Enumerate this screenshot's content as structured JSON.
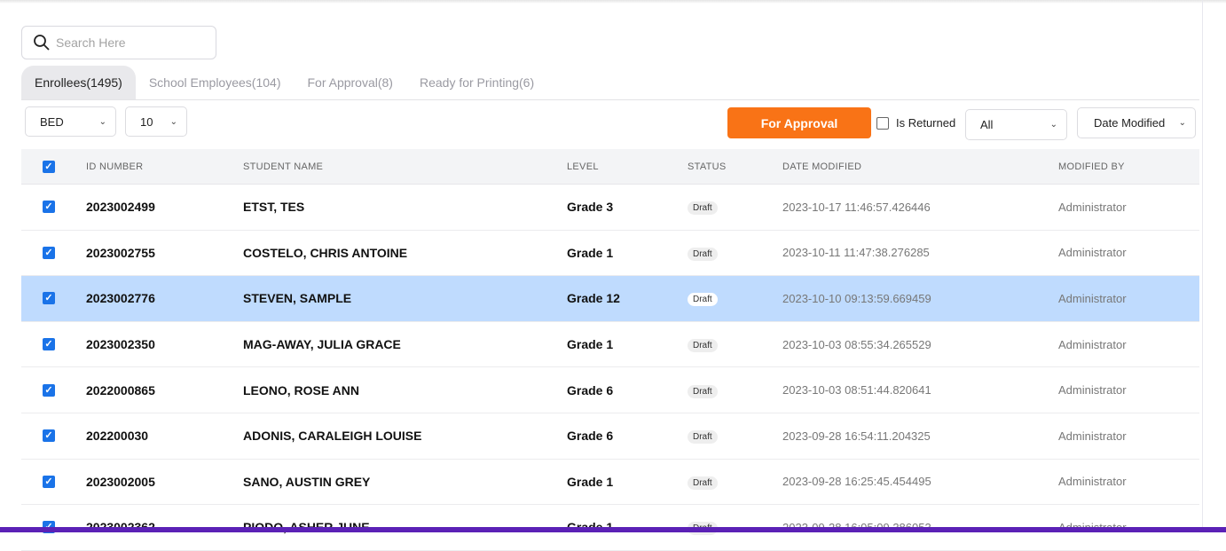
{
  "search": {
    "placeholder": "Search Here"
  },
  "tabs": [
    {
      "label": "Enrollees(1495)"
    },
    {
      "label": "School Employees(104)"
    },
    {
      "label": "For Approval(8)"
    },
    {
      "label": "Ready for Printing(6)"
    }
  ],
  "filters": {
    "department": "BED",
    "page_size": "10",
    "status_filter": "All",
    "sort": "Date Modified",
    "is_returned_label": "Is Returned",
    "for_approval_label": "For Approval"
  },
  "table": {
    "headers": [
      "ID NUMBER",
      "STUDENT NAME",
      "LEVEL",
      "STATUS",
      "DATE MODIFIED",
      "MODIFIED BY"
    ],
    "rows": [
      {
        "id": "2023002499",
        "name": "ETST, TES",
        "level": "Grade 3",
        "status": "Draft",
        "date": "2023-10-17 11:46:57.426446",
        "by": "Administrator"
      },
      {
        "id": "2023002755",
        "name": "COSTELO, CHRIS ANTOINE",
        "level": "Grade 1",
        "status": "Draft",
        "date": "2023-10-11 11:47:38.276285",
        "by": "Administrator"
      },
      {
        "id": "2023002776",
        "name": "STEVEN, SAMPLE",
        "level": "Grade 12",
        "status": "Draft",
        "date": "2023-10-10 09:13:59.669459",
        "by": "Administrator"
      },
      {
        "id": "2023002350",
        "name": "MAG-AWAY, JULIA GRACE",
        "level": "Grade 1",
        "status": "Draft",
        "date": "2023-10-03 08:55:34.265529",
        "by": "Administrator"
      },
      {
        "id": "2022000865",
        "name": "LEONO, ROSE ANN",
        "level": "Grade 6",
        "status": "Draft",
        "date": "2023-10-03 08:51:44.820641",
        "by": "Administrator"
      },
      {
        "id": "202200030",
        "name": "ADONIS, CARALEIGH LOUISE",
        "level": "Grade 6",
        "status": "Draft",
        "date": "2023-09-28 16:54:11.204325",
        "by": "Administrator"
      },
      {
        "id": "2023002005",
        "name": "SANO, AUSTIN GREY",
        "level": "Grade 1",
        "status": "Draft",
        "date": "2023-09-28 16:25:45.454495",
        "by": "Administrator"
      },
      {
        "id": "2023002362",
        "name": "PIODO, ASHER JUNE",
        "level": "Grade 1",
        "status": "Draft",
        "date": "2023-09-28 16:05:09.386053",
        "by": "Administrator"
      }
    ]
  },
  "colors": {
    "accent": "#f97316",
    "selected_row": "#bfdbfe",
    "bottom_bar": "#5b21b6"
  }
}
